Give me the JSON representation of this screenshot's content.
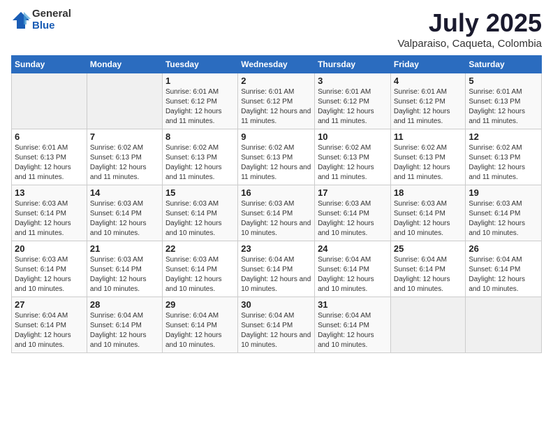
{
  "logo": {
    "general": "General",
    "blue": "Blue"
  },
  "header": {
    "title": "July 2025",
    "subtitle": "Valparaiso, Caqueta, Colombia"
  },
  "weekdays": [
    "Sunday",
    "Monday",
    "Tuesday",
    "Wednesday",
    "Thursday",
    "Friday",
    "Saturday"
  ],
  "weeks": [
    [
      {
        "day": "",
        "info": ""
      },
      {
        "day": "",
        "info": ""
      },
      {
        "day": "1",
        "info": "Sunrise: 6:01 AM\nSunset: 6:12 PM\nDaylight: 12 hours and 11 minutes."
      },
      {
        "day": "2",
        "info": "Sunrise: 6:01 AM\nSunset: 6:12 PM\nDaylight: 12 hours and 11 minutes."
      },
      {
        "day": "3",
        "info": "Sunrise: 6:01 AM\nSunset: 6:12 PM\nDaylight: 12 hours and 11 minutes."
      },
      {
        "day": "4",
        "info": "Sunrise: 6:01 AM\nSunset: 6:12 PM\nDaylight: 12 hours and 11 minutes."
      },
      {
        "day": "5",
        "info": "Sunrise: 6:01 AM\nSunset: 6:13 PM\nDaylight: 12 hours and 11 minutes."
      }
    ],
    [
      {
        "day": "6",
        "info": "Sunrise: 6:01 AM\nSunset: 6:13 PM\nDaylight: 12 hours and 11 minutes."
      },
      {
        "day": "7",
        "info": "Sunrise: 6:02 AM\nSunset: 6:13 PM\nDaylight: 12 hours and 11 minutes."
      },
      {
        "day": "8",
        "info": "Sunrise: 6:02 AM\nSunset: 6:13 PM\nDaylight: 12 hours and 11 minutes."
      },
      {
        "day": "9",
        "info": "Sunrise: 6:02 AM\nSunset: 6:13 PM\nDaylight: 12 hours and 11 minutes."
      },
      {
        "day": "10",
        "info": "Sunrise: 6:02 AM\nSunset: 6:13 PM\nDaylight: 12 hours and 11 minutes."
      },
      {
        "day": "11",
        "info": "Sunrise: 6:02 AM\nSunset: 6:13 PM\nDaylight: 12 hours and 11 minutes."
      },
      {
        "day": "12",
        "info": "Sunrise: 6:02 AM\nSunset: 6:13 PM\nDaylight: 12 hours and 11 minutes."
      }
    ],
    [
      {
        "day": "13",
        "info": "Sunrise: 6:03 AM\nSunset: 6:14 PM\nDaylight: 12 hours and 11 minutes."
      },
      {
        "day": "14",
        "info": "Sunrise: 6:03 AM\nSunset: 6:14 PM\nDaylight: 12 hours and 10 minutes."
      },
      {
        "day": "15",
        "info": "Sunrise: 6:03 AM\nSunset: 6:14 PM\nDaylight: 12 hours and 10 minutes."
      },
      {
        "day": "16",
        "info": "Sunrise: 6:03 AM\nSunset: 6:14 PM\nDaylight: 12 hours and 10 minutes."
      },
      {
        "day": "17",
        "info": "Sunrise: 6:03 AM\nSunset: 6:14 PM\nDaylight: 12 hours and 10 minutes."
      },
      {
        "day": "18",
        "info": "Sunrise: 6:03 AM\nSunset: 6:14 PM\nDaylight: 12 hours and 10 minutes."
      },
      {
        "day": "19",
        "info": "Sunrise: 6:03 AM\nSunset: 6:14 PM\nDaylight: 12 hours and 10 minutes."
      }
    ],
    [
      {
        "day": "20",
        "info": "Sunrise: 6:03 AM\nSunset: 6:14 PM\nDaylight: 12 hours and 10 minutes."
      },
      {
        "day": "21",
        "info": "Sunrise: 6:03 AM\nSunset: 6:14 PM\nDaylight: 12 hours and 10 minutes."
      },
      {
        "day": "22",
        "info": "Sunrise: 6:03 AM\nSunset: 6:14 PM\nDaylight: 12 hours and 10 minutes."
      },
      {
        "day": "23",
        "info": "Sunrise: 6:04 AM\nSunset: 6:14 PM\nDaylight: 12 hours and 10 minutes."
      },
      {
        "day": "24",
        "info": "Sunrise: 6:04 AM\nSunset: 6:14 PM\nDaylight: 12 hours and 10 minutes."
      },
      {
        "day": "25",
        "info": "Sunrise: 6:04 AM\nSunset: 6:14 PM\nDaylight: 12 hours and 10 minutes."
      },
      {
        "day": "26",
        "info": "Sunrise: 6:04 AM\nSunset: 6:14 PM\nDaylight: 12 hours and 10 minutes."
      }
    ],
    [
      {
        "day": "27",
        "info": "Sunrise: 6:04 AM\nSunset: 6:14 PM\nDaylight: 12 hours and 10 minutes."
      },
      {
        "day": "28",
        "info": "Sunrise: 6:04 AM\nSunset: 6:14 PM\nDaylight: 12 hours and 10 minutes."
      },
      {
        "day": "29",
        "info": "Sunrise: 6:04 AM\nSunset: 6:14 PM\nDaylight: 12 hours and 10 minutes."
      },
      {
        "day": "30",
        "info": "Sunrise: 6:04 AM\nSunset: 6:14 PM\nDaylight: 12 hours and 10 minutes."
      },
      {
        "day": "31",
        "info": "Sunrise: 6:04 AM\nSunset: 6:14 PM\nDaylight: 12 hours and 10 minutes."
      },
      {
        "day": "",
        "info": ""
      },
      {
        "day": "",
        "info": ""
      }
    ]
  ]
}
